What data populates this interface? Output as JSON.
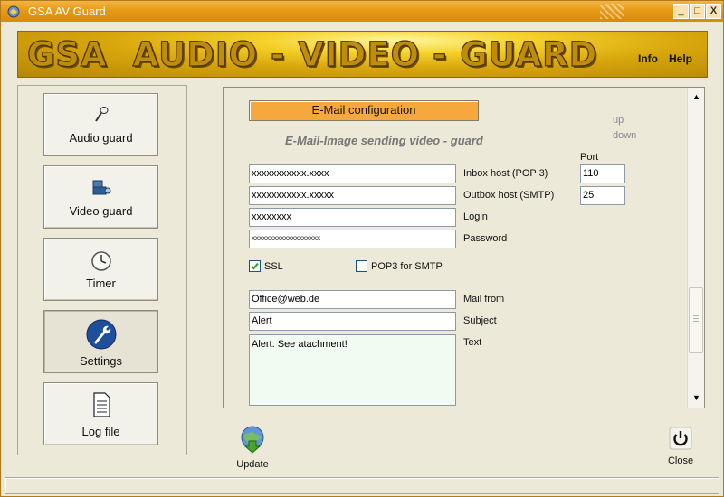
{
  "window": {
    "title": "GSA AV Guard",
    "controls": [
      "_",
      "□",
      "X"
    ]
  },
  "banner": {
    "logo_word_1": "GSA",
    "logo_word_2": "AUDIO - VIDEO - GUARD",
    "info": "Info",
    "help": "Help"
  },
  "sidebar": {
    "items": [
      {
        "label": "Audio guard",
        "icon": "microphone-icon"
      },
      {
        "label": "Video guard",
        "icon": "camera-icon"
      },
      {
        "label": "Timer",
        "icon": "clock-icon"
      },
      {
        "label": "Settings",
        "icon": "wrench-icon"
      },
      {
        "label": "Log file",
        "icon": "document-icon"
      }
    ],
    "selected": "Settings"
  },
  "email": {
    "section_title": "E-Mail configuration",
    "subtitle": "E-Mail-Image sending video - guard",
    "up": "up",
    "down": "down",
    "port_header": "Port",
    "inbox_host": "xxxxxxxxxxx.xxxx",
    "inbox_label": "Inbox host (POP 3)",
    "inbox_port": "110",
    "outbox_host": "xxxxxxxxxxx.xxxxx",
    "outbox_label": "Outbox host (SMTP)",
    "outbox_port": "25",
    "login": "xxxxxxxx",
    "login_label": "Login",
    "password": "xxxxxxxxxxxxxxxxxxx",
    "password_label": "Password",
    "ssl_label": "SSL",
    "ssl_checked": true,
    "pop3_smtp_label": "POP3 for SMTP",
    "pop3_smtp_checked": false,
    "mail_from": "Office@web.de",
    "mail_from_label": "Mail from",
    "subject": "Alert",
    "subject_label": "Subject",
    "text": "Alert. See atachment!",
    "text_label": "Text"
  },
  "actions": {
    "update": "Update",
    "close": "Close"
  },
  "colors": {
    "title_orange": "#e79a16",
    "section_button": "#f6a83c",
    "banner_gold": "#d7a50c"
  }
}
